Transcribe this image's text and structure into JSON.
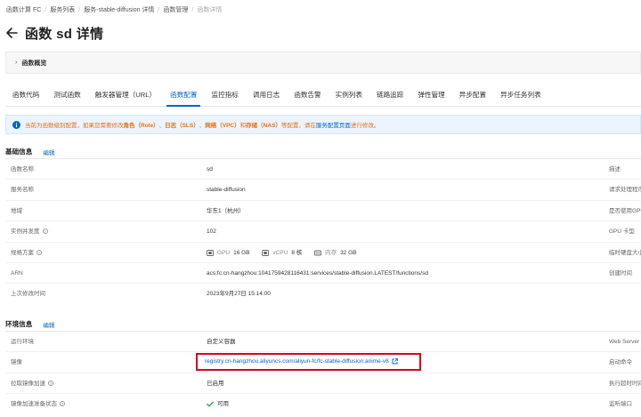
{
  "breadcrumb": [
    "函数计算 FC",
    "服务列表",
    "服务-stable-diffusion 详情",
    "函数管理",
    "函数详情"
  ],
  "title": "函数 sd 详情",
  "overview": {
    "label": "函数概览"
  },
  "tabs": [
    {
      "label": "函数代码"
    },
    {
      "label": "测试函数"
    },
    {
      "label": "触发器管理（URL）"
    },
    {
      "label": "函数配置",
      "active": true
    },
    {
      "label": "监控指标"
    },
    {
      "label": "调用日志"
    },
    {
      "label": "函数告警"
    },
    {
      "label": "实例列表"
    },
    {
      "label": "链路追踪"
    },
    {
      "label": "弹性管理"
    },
    {
      "label": "异步配置"
    },
    {
      "label": "异步任务列表"
    }
  ],
  "notice": {
    "prefix": "当前为函数级别配置，如果您需要修改",
    "role": "角色（Role）",
    "sep1": "、",
    "log": "日志（SLS）",
    "sep2": "、",
    "vpc": "网络（VPC）",
    "and": "和",
    "nas": "存储（NAS）",
    "mid": "等配置，请在",
    "link": "服务配置页面",
    "suffix": "进行修改。"
  },
  "basic": {
    "title": "基础信息",
    "edit": "编辑",
    "rows": [
      {
        "label": "函数名称",
        "value": "sd",
        "right": "描述"
      },
      {
        "label": "服务名称",
        "value": "stable-diffusion",
        "right": "请求处理程序"
      },
      {
        "label": "地域",
        "value": "华东1（杭州）",
        "right": "是否使用GPU"
      },
      {
        "label": "实例并发度",
        "value": "102",
        "right": "GPU 卡型"
      },
      {
        "label": "规格方案",
        "value": "",
        "right": "临时硬盘大小"
      },
      {
        "label": "ARN",
        "value": "acs:fc:cn-hangzhou:1041759428116431:services/stable-diffusion.LATEST/functions/sd",
        "right": "创建时间"
      },
      {
        "label": "上次修改时间",
        "value": "2023年9月27日 15:14:00",
        "right": ""
      }
    ],
    "spec": {
      "gpu_label": "GPU",
      "gpu_value": "16 GB",
      "vcpu_label": "vCPU",
      "vcpu_value": "8 核",
      "mem_label": "内存",
      "mem_value": "32 GB"
    }
  },
  "env": {
    "title": "环境信息",
    "edit": "编辑",
    "rows": [
      {
        "label": "运行环境",
        "value": "自定义容器",
        "right": "Web Server"
      },
      {
        "label": "镜像",
        "value": "registry.cn-hangzhou.aliyuncs.com/aliyun-fc/fc-stable-diffusion:anime-v8",
        "right": "启动命令"
      },
      {
        "label": "拉取镜像加速",
        "value": "已启用",
        "right": "执行超时时间"
      },
      {
        "label": "镜像加速准备状态",
        "value": "可用",
        "right": "监听端口"
      }
    ]
  },
  "colors": {
    "accent": "#0064c8",
    "warning": "#e8700f",
    "highlight_box": "#d9001b",
    "success": "#1a9c3c"
  }
}
